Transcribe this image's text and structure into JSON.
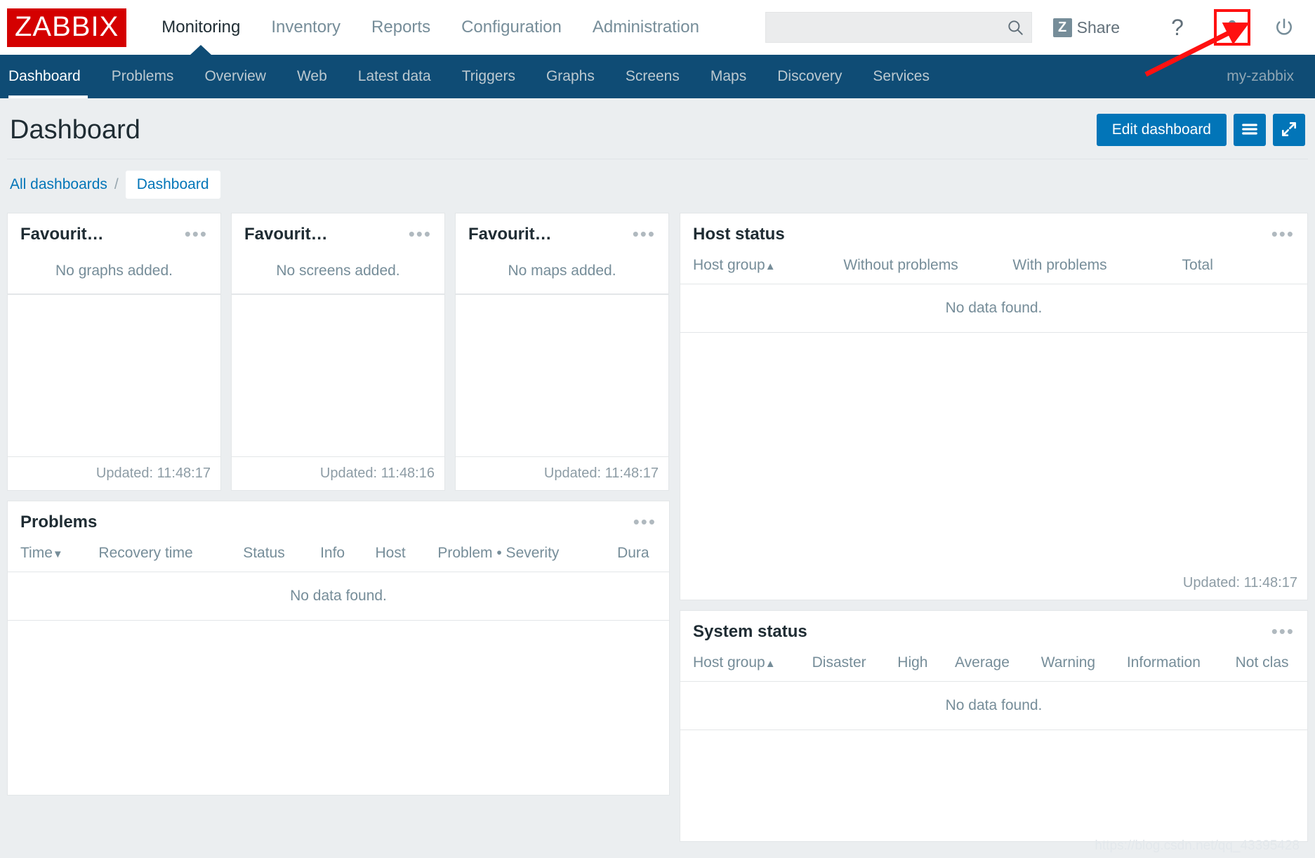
{
  "brand": {
    "logo_text": "ZABBIX",
    "logo_color": "#d40000"
  },
  "header": {
    "nav": [
      {
        "label": "Monitoring",
        "active": true
      },
      {
        "label": "Inventory",
        "active": false
      },
      {
        "label": "Reports",
        "active": false
      },
      {
        "label": "Configuration",
        "active": false
      },
      {
        "label": "Administration",
        "active": false
      }
    ],
    "search": {
      "value": "",
      "placeholder": ""
    },
    "share": {
      "badge": "Z",
      "label": "Share"
    },
    "help_label": "?",
    "icons": {
      "search": "search-icon",
      "help": "question-mark-icon",
      "user": "user-profile-icon",
      "signout": "power-signout-icon"
    }
  },
  "subnav": {
    "items": [
      {
        "label": "Dashboard",
        "active": true
      },
      {
        "label": "Problems",
        "active": false
      },
      {
        "label": "Overview",
        "active": false
      },
      {
        "label": "Web",
        "active": false
      },
      {
        "label": "Latest data",
        "active": false
      },
      {
        "label": "Triggers",
        "active": false
      },
      {
        "label": "Graphs",
        "active": false
      },
      {
        "label": "Screens",
        "active": false
      },
      {
        "label": "Maps",
        "active": false
      },
      {
        "label": "Discovery",
        "active": false
      },
      {
        "label": "Services",
        "active": false
      }
    ],
    "server_label": "my-zabbix"
  },
  "page": {
    "title": "Dashboard",
    "edit_button": "Edit dashboard",
    "breadcrumb": {
      "all_dashboards": "All dashboards",
      "separator": "/",
      "current": "Dashboard"
    }
  },
  "widgets": {
    "favourite_graphs": {
      "title": "Favourit…",
      "empty": "No graphs added.",
      "updated": "Updated: 11:48:17"
    },
    "favourite_screens": {
      "title": "Favourit…",
      "empty": "No screens added.",
      "updated": "Updated: 11:48:16"
    },
    "favourite_maps": {
      "title": "Favourit…",
      "empty": "No maps added.",
      "updated": "Updated: 11:48:17"
    },
    "host_status": {
      "title": "Host status",
      "columns": [
        "Host group",
        "Without problems",
        "With problems",
        "Total"
      ],
      "sort_column": "Host group",
      "sort_direction": "asc",
      "empty": "No data found.",
      "updated": "Updated: 11:48:17"
    },
    "problems": {
      "title": "Problems",
      "columns": [
        "Time",
        "Recovery time",
        "Status",
        "Info",
        "Host",
        "Problem • Severity",
        "Dura"
      ],
      "sort_column": "Time",
      "sort_direction": "desc",
      "empty": "No data found."
    },
    "system_status": {
      "title": "System status",
      "columns": [
        "Host group",
        "Disaster",
        "High",
        "Average",
        "Warning",
        "Information",
        "Not clas"
      ],
      "sort_column": "Host group",
      "sort_direction": "asc",
      "empty": "No data found."
    }
  },
  "watermark": "https://blog.csdn.net/qq_43395428",
  "colors": {
    "brand_red": "#d40000",
    "nav_dark_blue": "#0f4c75",
    "accent_blue": "#0275b8",
    "page_bg": "#ebeef0",
    "annotation_red": "#ff1111"
  }
}
